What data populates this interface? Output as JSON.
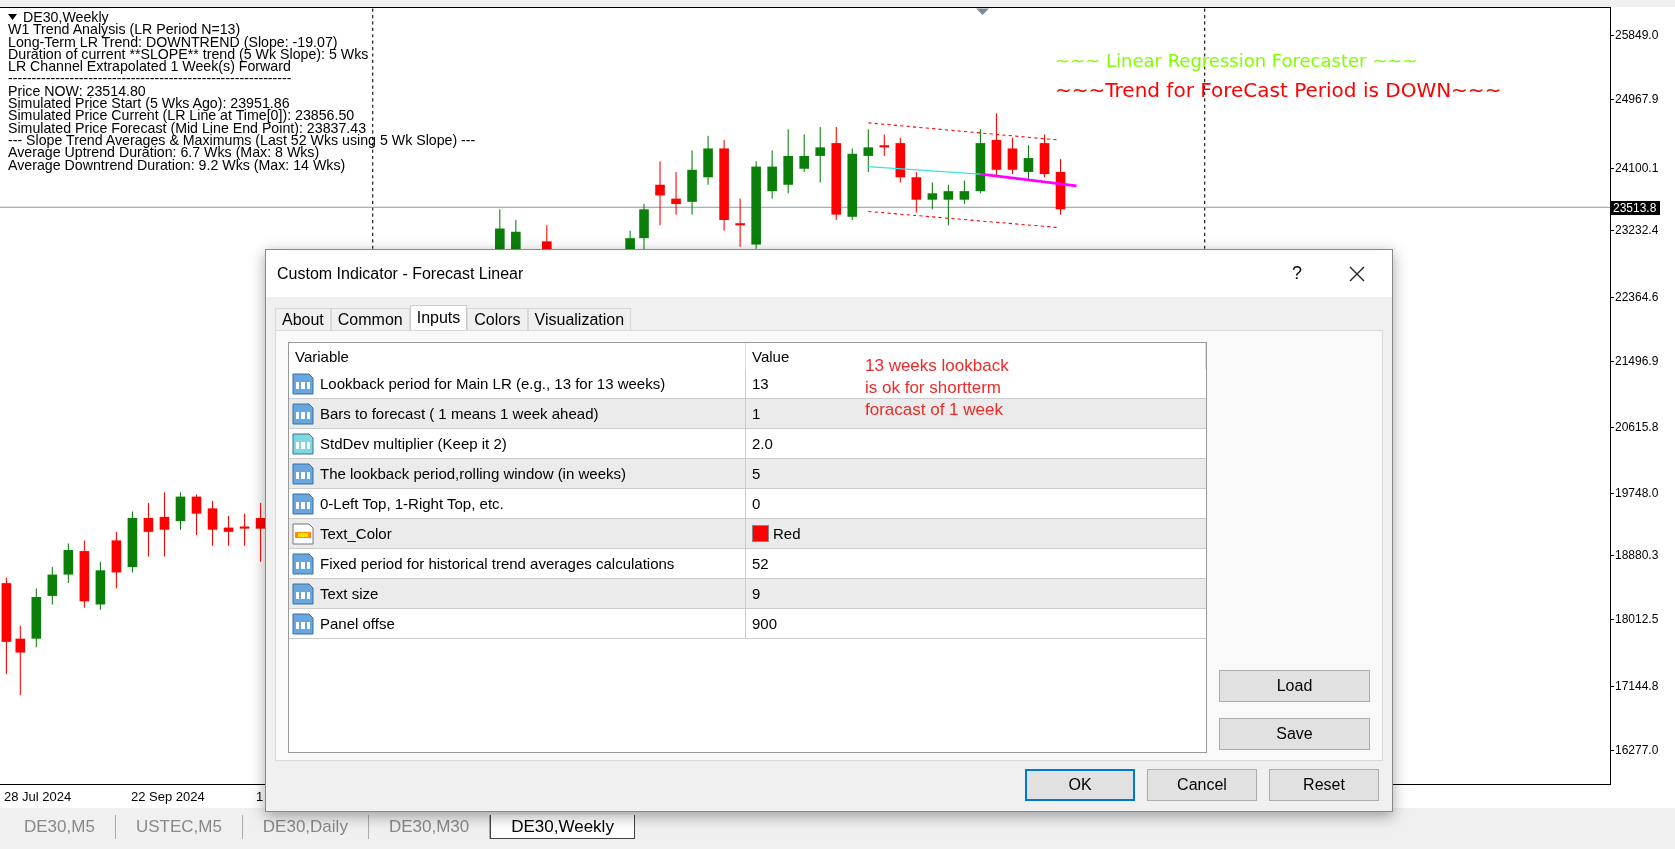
{
  "chart": {
    "symbol_title": "DE30,Weekly",
    "info_lines": [
      "W1 Trend Analysis (LR Period N=13)",
      "Long-Term LR Trend: DOWNTREND (Slope: -19.07)",
      "Duration of current **SLOPE** trend (5 Wk Slope): 5 Wks",
      "LR Channel Extrapolated 1 Week(s) Forward",
      "------------------------------------------------------------",
      "Price NOW: 23514.80",
      "Simulated Price Start (5 Wks Ago): 23951.86",
      "Simulated Price Current (LR Line at Time[0]): 23856.50",
      "Simulated Price Forecast (Mid Line End Point): 23837.43",
      "--- Slope Trend Averages & Maximums (Last 52 Wks using 5 Wk Slope) ---",
      "Average Uptrend Duration: 6.7 Wks (Max: 8 Wks)",
      "Average Downtrend Duration: 9.2 Wks (Max: 14 Wks)"
    ],
    "headline": "~~~ Linear Regression Forecaster ~~~",
    "trend_message": "~~~Trend for ForeCast Period is DOWN~~~",
    "price_axis": [
      "25849.0",
      "24967.9",
      "24100.1",
      "23232.4",
      "22364.6",
      "21496.9",
      "20615.8",
      "19748.0",
      "18880.3",
      "18012.5",
      "17144.8",
      "16277.0"
    ],
    "current_price": "23513.8",
    "date_axis": [
      "28 Jul 2024",
      "22 Sep 2024",
      "1"
    ]
  },
  "dialog": {
    "title": "Custom Indicator - Forecast Linear",
    "help": "?",
    "tabs": [
      {
        "label": "About",
        "selected": false
      },
      {
        "label": "Common",
        "selected": false
      },
      {
        "label": "Inputs",
        "selected": true
      },
      {
        "label": "Colors",
        "selected": false
      },
      {
        "label": "Visualization",
        "selected": false
      }
    ],
    "table": {
      "columns": [
        "Variable",
        "Value"
      ],
      "rows": [
        {
          "kind": "integer",
          "variable": "Lookback period for Main LR (e.g., 13 for 13 weeks)",
          "value": "13"
        },
        {
          "kind": "integer",
          "variable": "Bars to forecast ( 1 means 1 week ahead)",
          "value": "1"
        },
        {
          "kind": "double",
          "variable": "StdDev multiplier (Keep it 2)",
          "value": "2.0"
        },
        {
          "kind": "integer",
          "variable": "The lookback period,rolling window (in weeks)",
          "value": "5"
        },
        {
          "kind": "integer",
          "variable": "0-Left Top, 1-Right Top, etc.",
          "value": "0"
        },
        {
          "kind": "color",
          "variable": "Text_Color",
          "value": "Red",
          "color": "#ff0000"
        },
        {
          "kind": "integer",
          "variable": "Fixed period for historical trend averages calculations",
          "value": "52"
        },
        {
          "kind": "integer",
          "variable": "Text size",
          "value": "9"
        },
        {
          "kind": "integer",
          "variable": "Panel offse",
          "value": "900"
        }
      ]
    },
    "note_lines": [
      "13 weeks lookback",
      "is ok for shortterm",
      "foracast of 1 week"
    ],
    "side_buttons": [
      "Load",
      "Save"
    ],
    "buttons": [
      {
        "label": "OK",
        "default": true
      },
      {
        "label": "Cancel",
        "default": false
      },
      {
        "label": "Reset",
        "default": false
      }
    ]
  },
  "tabs": [
    {
      "label": "DE30,M5",
      "selected": false
    },
    {
      "label": "USTEC,M5",
      "selected": false
    },
    {
      "label": "DE30,Daily",
      "selected": false
    },
    {
      "label": "DE30,M30",
      "selected": false
    },
    {
      "label": "DE30,Weekly",
      "selected": true
    }
  ]
}
